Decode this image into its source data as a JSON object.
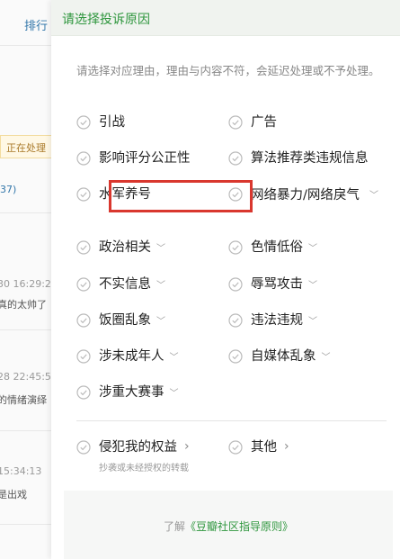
{
  "background": {
    "tab_label": "排行",
    "status_badge": "正在处理",
    "count_text": "37)",
    "items": [
      {
        "time": "30 16:29:2",
        "body": "真的太帅了"
      },
      {
        "time": "28 22:45:5",
        "body": "的情绪演绎"
      },
      {
        "time": "15:34:13",
        "body": "是出戏"
      }
    ]
  },
  "dialog": {
    "title": "请选择投诉原因",
    "note": "请选择对应理由，理由与内容不符，会延迟处理或不予处理。",
    "options": [
      {
        "label": "引战",
        "caret": ""
      },
      {
        "label": "广告",
        "caret": ""
      },
      {
        "label": "影响评分公正性",
        "caret": ""
      },
      {
        "label": "算法推荐类违规信息",
        "caret": ""
      },
      {
        "label": "水军养号",
        "caret": ""
      },
      {
        "label": "网络暴力/网络戾气",
        "caret": "﹀"
      },
      {
        "label": "政治相关",
        "caret": "﹀"
      },
      {
        "label": "色情低俗",
        "caret": "﹀"
      },
      {
        "label": "不实信息",
        "caret": "﹀"
      },
      {
        "label": "辱骂攻击",
        "caret": "﹀"
      },
      {
        "label": "饭圈乱象",
        "caret": "﹀"
      },
      {
        "label": "违法违规",
        "caret": "﹀"
      },
      {
        "label": "涉未成年人",
        "caret": "﹀"
      },
      {
        "label": "自媒体乱象",
        "caret": "﹀"
      },
      {
        "label": "涉重大赛事",
        "caret": "﹀"
      }
    ],
    "rights_option": {
      "label": "侵犯我的权益",
      "caret": "›",
      "sub": "抄袭或未经授权的转载"
    },
    "other_option": {
      "label": "其他",
      "caret": "›"
    },
    "footer": {
      "prefix": "了解",
      "link": "《豆瓣社区指导原则》"
    }
  },
  "colors": {
    "accent_green": "#2e963d",
    "highlight_red": "#d9372e"
  },
  "icons": {
    "option_check": "circle-check-icon",
    "dropdown": "chevron-down-icon",
    "submenu": "chevron-right-icon"
  }
}
